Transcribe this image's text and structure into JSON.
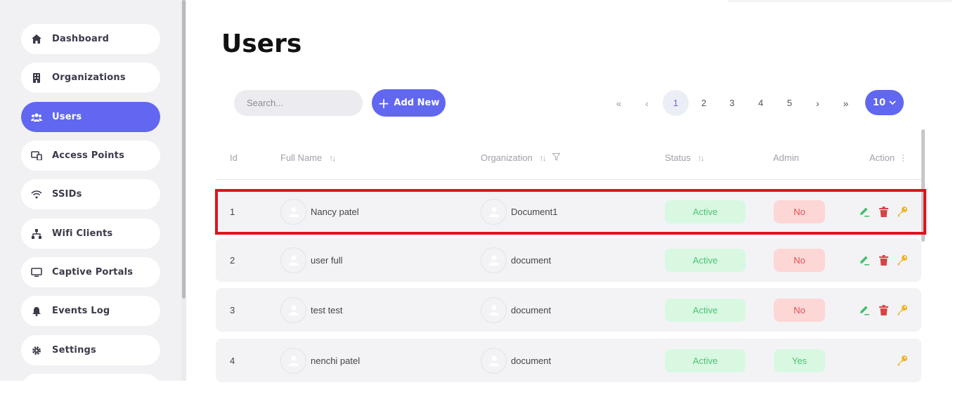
{
  "sidebar": {
    "items": [
      {
        "label": "Dashboard",
        "icon": "home-icon",
        "active": false
      },
      {
        "label": "Organizations",
        "icon": "building-icon",
        "active": false
      },
      {
        "label": "Users",
        "icon": "users-icon",
        "active": true
      },
      {
        "label": "Access Points",
        "icon": "devices-icon",
        "active": false
      },
      {
        "label": "SSIDs",
        "icon": "wifi-icon",
        "active": false
      },
      {
        "label": "Wifi Clients",
        "icon": "network-icon",
        "active": false
      },
      {
        "label": "Captive Portals",
        "icon": "monitor-icon",
        "active": false
      },
      {
        "label": "Events Log",
        "icon": "bell-icon",
        "active": false
      },
      {
        "label": "Settings",
        "icon": "gear-icon",
        "active": false
      }
    ]
  },
  "page": {
    "title": "Users"
  },
  "toolbar": {
    "search_placeholder": "Search...",
    "add_label": "Add New"
  },
  "pagination": {
    "pages": [
      "1",
      "2",
      "3",
      "4",
      "5"
    ],
    "current": "1",
    "per_page": "10"
  },
  "table": {
    "columns": {
      "id": "Id",
      "full_name": "Full Name",
      "organization": "Organization",
      "status": "Status",
      "admin": "Admin",
      "action": "Action"
    },
    "rows": [
      {
        "id": "1",
        "full_name": "Nancy patel",
        "organization": "Document1",
        "status": "Active",
        "admin": "No"
      },
      {
        "id": "2",
        "full_name": "user full",
        "organization": "document",
        "status": "Active",
        "admin": "No"
      },
      {
        "id": "3",
        "full_name": "test test",
        "organization": "document",
        "status": "Active",
        "admin": "No"
      },
      {
        "id": "4",
        "full_name": "nenchi patel",
        "organization": "document",
        "status": "Active",
        "admin": "Yes"
      }
    ]
  },
  "colors": {
    "accent": "#6167f0",
    "active_green": "#4cc470",
    "no_red": "#e05252",
    "edit_green": "#3fbf6a",
    "delete_red": "#d64545",
    "key_gold": "#f0b429",
    "highlight_red": "#e0131f"
  }
}
